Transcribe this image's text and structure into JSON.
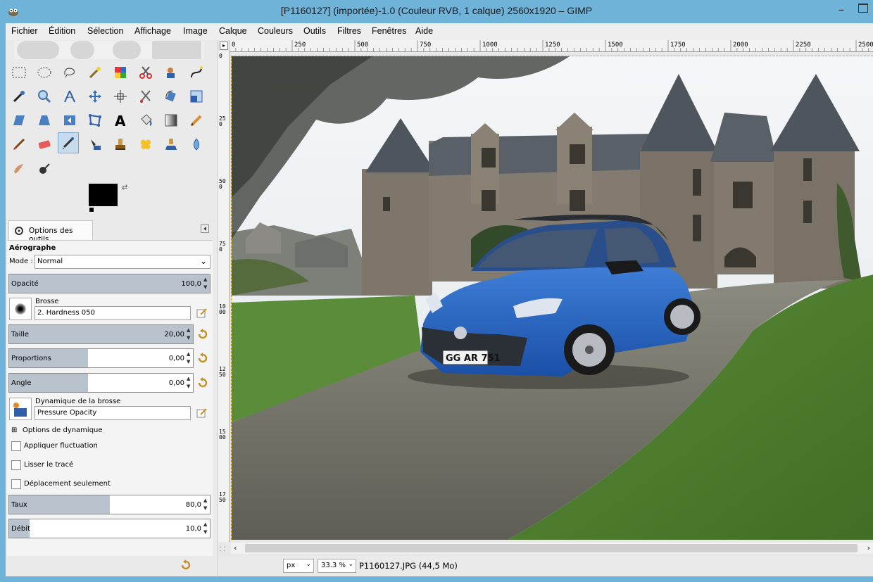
{
  "window": {
    "title": "[P1160127] (importée)-1.0 (Couleur RVB, 1 calque) 2560x1920 – GIMP",
    "app_icon": "gimp-icon",
    "minimize_glyph": "–",
    "accent": "#6fb3d9"
  },
  "menu": [
    "Fichier",
    "Édition",
    "Sélection",
    "Affichage",
    "Image",
    "Calque",
    "Couleurs",
    "Outils",
    "Filtres",
    "Fenêtres",
    "Aide"
  ],
  "toolbox": {
    "tools": [
      "rect-select",
      "ellipse-select",
      "free-select",
      "fuzzy-select",
      "select-by-color",
      "scissors-select",
      "foreground-select",
      "paths",
      "color-picker",
      "zoom",
      "measure",
      "move",
      "align",
      "crop",
      "rotate",
      "scale",
      "shear",
      "perspective",
      "flip",
      "cage-transform",
      "unified-transform",
      "text",
      "bucket-fill",
      "blend",
      "pencil",
      "paintbrush",
      "eraser",
      "airbrush",
      "ink",
      "clone",
      "heal",
      "perspective-clone",
      "smudge",
      "blur-sharpen",
      "dodge-burn"
    ],
    "active_tool": "airbrush",
    "foreground_color": "#000000",
    "background_color": "#ffffff"
  },
  "tool_options": {
    "tab_label": "Options des outils",
    "tool_name": "Aérographe",
    "mode_label": "Mode :",
    "mode_value": "Normal",
    "opacity": {
      "label": "Opacité",
      "value": "100,0",
      "fraction": 1.0
    },
    "brush_label": "Brosse",
    "brush_value": "2. Hardness 050",
    "size": {
      "label": "Taille",
      "value": "20,00",
      "fraction": 1.0
    },
    "aspect": {
      "label": "Proportions",
      "value": "0,00",
      "fraction": 0.43
    },
    "angle": {
      "label": "Angle",
      "value": "0,00",
      "fraction": 0.43
    },
    "dynamics_label": "Dynamique de la brosse",
    "dynamics_value": "Pressure Opacity",
    "dynamics_options": "Options de dynamique",
    "apply_jitter": "Appliquer fluctuation",
    "smooth_stroke": "Lisser le tracé",
    "incremental": "Déplacement seulement",
    "rate": {
      "label": "Taux",
      "value": "80,0",
      "fraction": 0.5
    },
    "flow": {
      "label": "Débit",
      "value": "10,0",
      "fraction": 0.1
    }
  },
  "rulers": {
    "horizontal": [
      "0",
      "250",
      "500",
      "750",
      "1000",
      "1250",
      "1500",
      "1750",
      "2000",
      "2250",
      "2500"
    ],
    "vertical": [
      "0",
      "250",
      "500",
      "750",
      "1000",
      "1250",
      "1500",
      "1750"
    ]
  },
  "canvas": {
    "plate": "GG AR 751"
  },
  "status": {
    "unit": "px",
    "zoom": "33.3 %",
    "file_info": "P1160127.JPG (44,5 Mo)"
  }
}
